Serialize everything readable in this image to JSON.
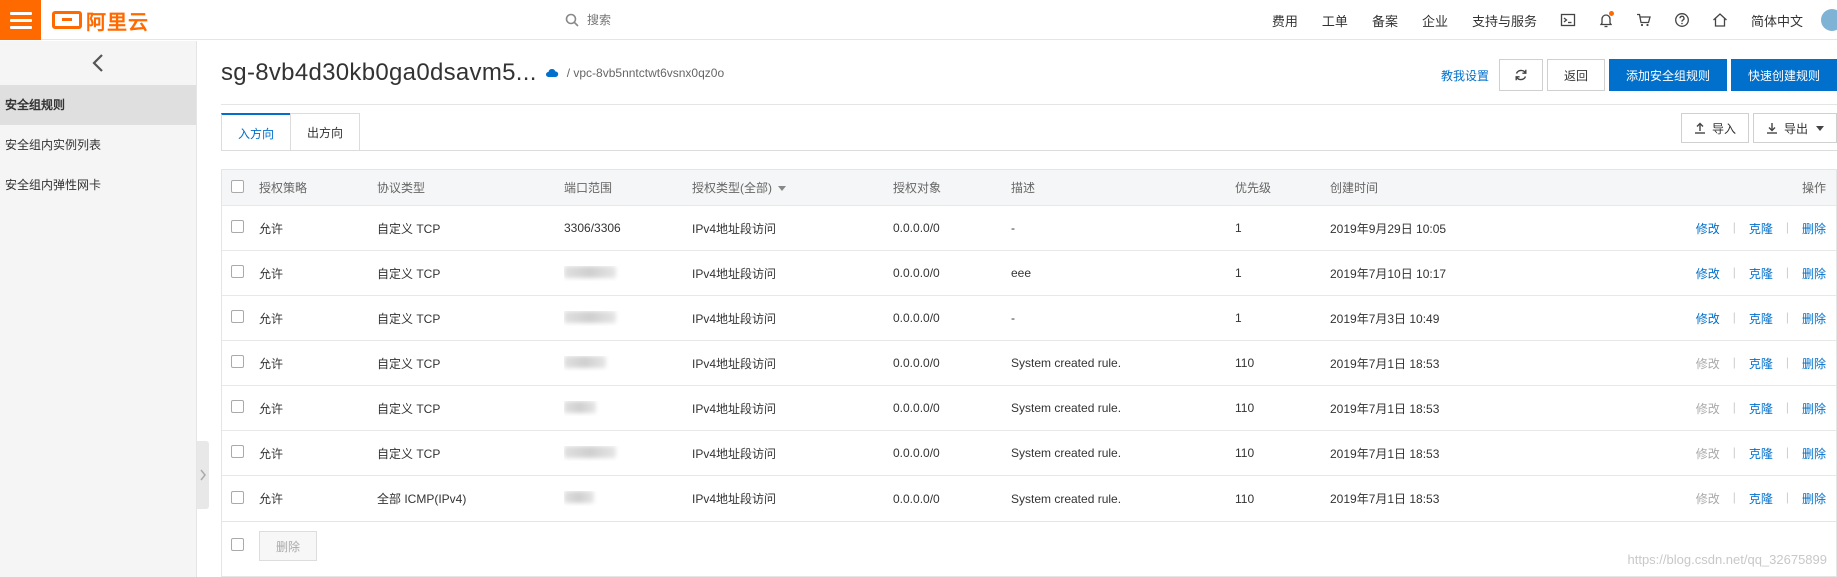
{
  "topbar": {
    "logo_text": "阿里云",
    "search_placeholder": "搜索",
    "nav": [
      "费用",
      "工单",
      "备案",
      "企业",
      "支持与服务"
    ],
    "language": "简体中文",
    "accent_color": "#ff6a00"
  },
  "sidebar": {
    "items": [
      {
        "label": "安全组规则",
        "active": true
      },
      {
        "label": "安全组内实例列表",
        "active": false
      },
      {
        "label": "安全组内弹性网卡",
        "active": false
      }
    ]
  },
  "header": {
    "title": "sg-8vb4d30kb0ga0dsavm5...",
    "vpc": "/ vpc-8vb5nntctwt6vsnx0qz0o",
    "help_link": "教我设置",
    "back": "返回",
    "add_rule": "添加安全组规则",
    "quick_create": "快速创建规则",
    "primary_color": "#0070cc"
  },
  "tabs": [
    {
      "label": "入方向",
      "active": true
    },
    {
      "label": "出方向",
      "active": false
    }
  ],
  "tab_actions": {
    "import": "导入",
    "export": "导出"
  },
  "table": {
    "columns": [
      "授权策略",
      "协议类型",
      "端口范围",
      "授权类型(全部)",
      "授权对象",
      "描述",
      "优先级",
      "创建时间",
      "操作"
    ],
    "rows": [
      {
        "policy": "允许",
        "protocol": "自定义 TCP",
        "port": "3306/3306",
        "auth_type": "IPv4地址段访问",
        "auth_obj": "0.0.0.0/0",
        "desc": "-",
        "priority": "1",
        "time": "2019年9月29日 10:05",
        "edit_enabled": true
      },
      {
        "policy": "允许",
        "protocol": "自定义 TCP",
        "port": "",
        "auth_type": "IPv4地址段访问",
        "auth_obj": "0.0.0.0/0",
        "desc": "eee",
        "priority": "1",
        "time": "2019年7月10日 10:17",
        "edit_enabled": true
      },
      {
        "policy": "允许",
        "protocol": "自定义 TCP",
        "port": "",
        "auth_type": "IPv4地址段访问",
        "auth_obj": "0.0.0.0/0",
        "desc": "-",
        "priority": "1",
        "time": "2019年7月3日 10:49",
        "edit_enabled": true
      },
      {
        "policy": "允许",
        "protocol": "自定义 TCP",
        "port": "",
        "auth_type": "IPv4地址段访问",
        "auth_obj": "0.0.0.0/0",
        "desc": "System created rule.",
        "priority": "110",
        "time": "2019年7月1日 18:53",
        "edit_enabled": false
      },
      {
        "policy": "允许",
        "protocol": "自定义 TCP",
        "port": "",
        "auth_type": "IPv4地址段访问",
        "auth_obj": "0.0.0.0/0",
        "desc": "System created rule.",
        "priority": "110",
        "time": "2019年7月1日 18:53",
        "edit_enabled": false
      },
      {
        "policy": "允许",
        "protocol": "自定义 TCP",
        "port": "",
        "auth_type": "IPv4地址段访问",
        "auth_obj": "0.0.0.0/0",
        "desc": "System created rule.",
        "priority": "110",
        "time": "2019年7月1日 18:53",
        "edit_enabled": false
      },
      {
        "policy": "允许",
        "protocol": "全部 ICMP(IPv4)",
        "port": "",
        "auth_type": "IPv4地址段访问",
        "auth_obj": "0.0.0.0/0",
        "desc": "System created rule.",
        "priority": "110",
        "time": "2019年7月1日 18:53",
        "edit_enabled": false
      }
    ],
    "ops": {
      "edit": "修改",
      "clone": "克隆",
      "delete": "删除"
    }
  },
  "footer": {
    "delete_button": "删除"
  },
  "watermark": "https://blog.csdn.net/qq_32675899"
}
